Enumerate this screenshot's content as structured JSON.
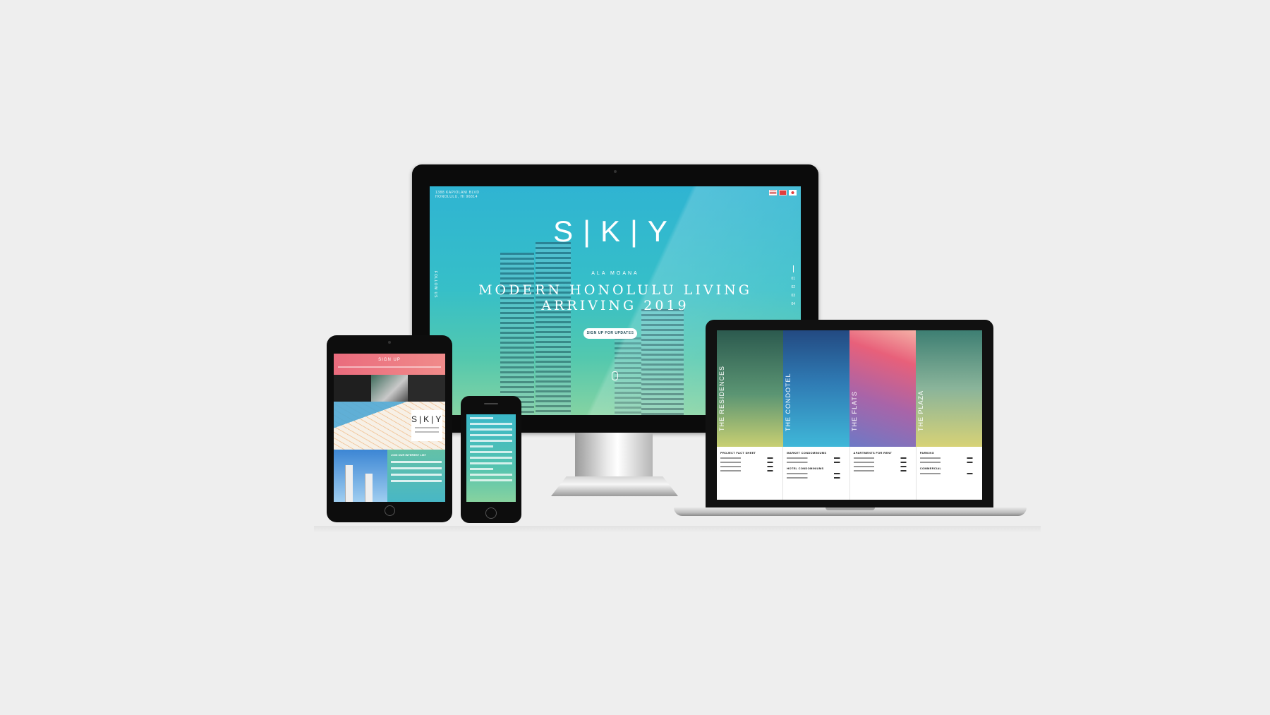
{
  "desktop": {
    "address": "1388 KAPIOLANI BLVD HONOLULU, HI 96814",
    "logo": "S|K|Y",
    "logo_sub": "ALA MOANA",
    "headline_line1": "MODERN HONOLULU LIVING",
    "headline_line2": "ARRIVING 2019",
    "cta_label": "SIGN UP FOR UPDATES",
    "follow_label": "FOLLOW US",
    "pager": [
      "01",
      "02",
      "03",
      "04"
    ]
  },
  "laptop": {
    "columns": [
      "THE RESIDENCES",
      "THE CONDOTEL",
      "THE FLATS",
      "THE PLAZA"
    ],
    "facts": [
      "PROJECT FACT SHEET",
      "MARKET CONDOMINIUMS",
      "APARTMENTS FOR RENT",
      "PARKING"
    ],
    "facts_secondary": [
      "",
      "HOTEL CONDOMINIUMS",
      "",
      "COMMERCIAL"
    ]
  },
  "tablet": {
    "header_title": "SIGN UP",
    "card_logo": "S|K|Y",
    "form_title": "JOIN OUR INTEREST LIST"
  },
  "colors": {
    "background": "#eeeeee",
    "cta_text": "#1e4a55",
    "tablet_header": "#ea6b7d"
  }
}
